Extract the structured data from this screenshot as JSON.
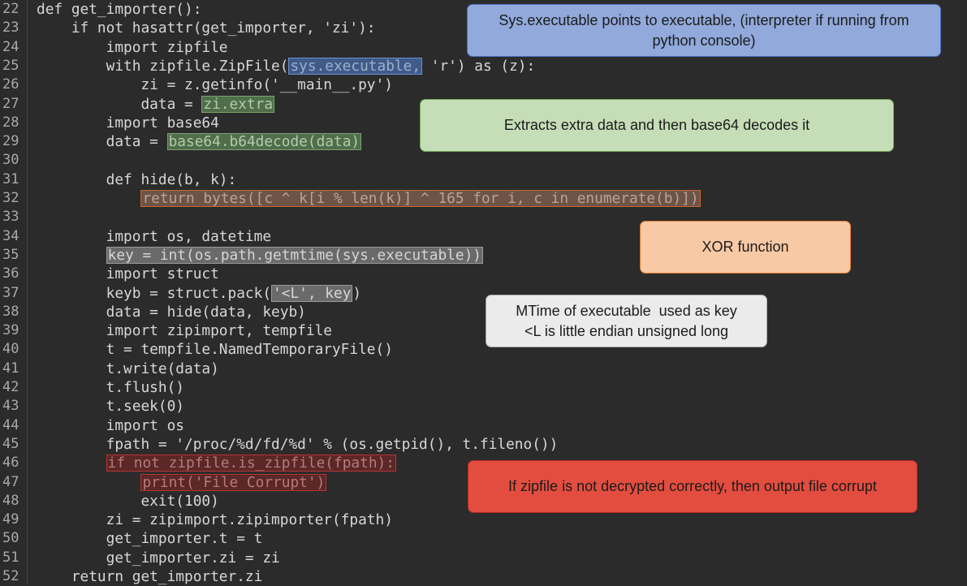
{
  "line_numbers": [
    "22",
    "23",
    "24",
    "25",
    "26",
    "27",
    "28",
    "29",
    "30",
    "31",
    "32",
    "33",
    "34",
    "35",
    "36",
    "37",
    "38",
    "39",
    "40",
    "41",
    "42",
    "43",
    "44",
    "45",
    "46",
    "47",
    "48",
    "49",
    "50",
    "51",
    "52"
  ],
  "code": {
    "l22": "def get_importer():",
    "l23": "    if not hasattr(get_importer, 'zi'):",
    "l24": "        import zipfile",
    "l25_pre": "        with zipfile.ZipFile(",
    "l25_hl": "sys.executable,",
    "l25_post": " 'r') as (z):",
    "l26": "            zi = z.getinfo('__main__.py')",
    "l27_pre": "            data = ",
    "l27_hl": "zi.extra",
    "l28": "        import base64",
    "l29_pre": "        data = ",
    "l29_hl": "base64.b64decode(data)",
    "l30": "",
    "l31": "        def hide(b, k):",
    "l32_pre": "            ",
    "l32_hl": "return bytes([c ^ k[i % len(k)] ^ 165 for i, c in enumerate(b)])",
    "l33": "",
    "l34": "        import os, datetime",
    "l35_pre": "        ",
    "l35_hl": "key = int(os.path.getmtime(sys.executable))",
    "l36": "        import struct",
    "l37_pre": "        keyb = struct.pack(",
    "l37_hl": "'<L', key",
    "l37_post": ")",
    "l38": "        data = hide(data, keyb)",
    "l39": "        import zipimport, tempfile",
    "l40": "        t = tempfile.NamedTemporaryFile()",
    "l41": "        t.write(data)",
    "l42": "        t.flush()",
    "l43": "        t.seek(0)",
    "l44": "        import os",
    "l45": "        fpath = '/proc/%d/fd/%d' % (os.getpid(), t.fileno())",
    "l46_pre": "        ",
    "l46_hl": "if not zipfile.is_zipfile(fpath):",
    "l47_pre": "            ",
    "l47_hl": "print('File Corrupt')",
    "l48": "            exit(100)",
    "l49": "        zi = zipimport.zipimporter(fpath)",
    "l50": "        get_importer.t = t",
    "l51": "        get_importer.zi = zi",
    "l52": "    return get_importer.zi"
  },
  "annotations": {
    "sys_executable_line1": "Sys.executable points to executable, (interpreter if running from",
    "sys_executable_line2": "python console)",
    "base64": "Extracts extra data and then base64 decodes it",
    "xor": "XOR function",
    "mtime_line1": "MTime of executable  used as key",
    "mtime_line2": "<L is little endian unsigned long",
    "zipfile": "If zipfile is not decrypted correctly, then output file corrupt"
  },
  "colors": {
    "background": "#2b2b2b",
    "note_blue": "#91a9db",
    "note_green": "#c5deb7",
    "note_orange": "#f8c9a5",
    "note_gray": "#ebebeb",
    "note_red": "#e34d3f"
  }
}
